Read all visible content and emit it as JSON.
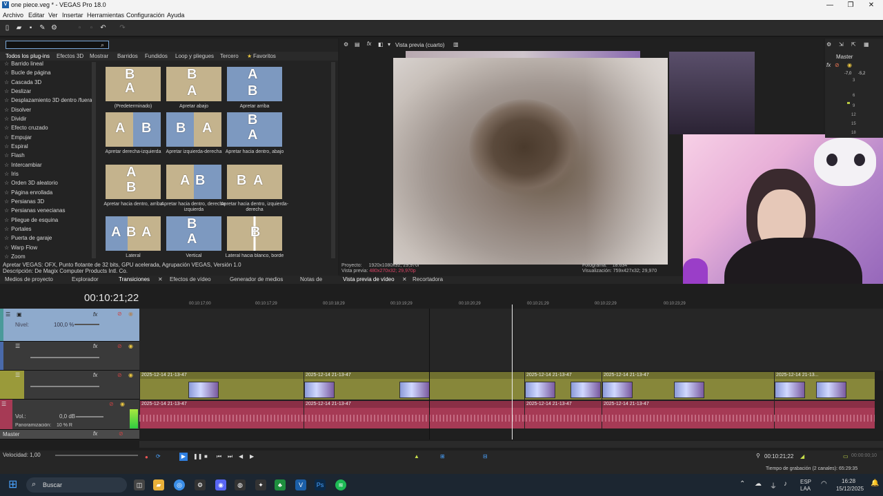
{
  "window": {
    "title": "one piece.veg * - VEGAS Pro 18.0"
  },
  "menu": [
    "Archivo",
    "Editar",
    "Ver",
    "Insertar",
    "Herramientas",
    "Configuración",
    "Ayuda"
  ],
  "plugin_tabs": [
    "Todos los plug-ins",
    "Efectos 3D",
    "Mostrar",
    "Barridos",
    "Fundidos",
    "Loop y pliegues",
    "Tercero",
    "Favoritos"
  ],
  "transitions_list": [
    "Barrido lineal",
    "Bucle de página",
    "Cascada 3D",
    "Deslizar",
    "Desplazamiento 3D dentro /fuera",
    "Disolver",
    "Dividir",
    "Efecto cruzado",
    "Empujar",
    "Espiral",
    "Flash",
    "Intercambiar",
    "Iris",
    "Orden 3D aleatorio",
    "Página enrollada",
    "Persianas 3D",
    "Persianas venecianas",
    "Pliegue de esquina",
    "Portales",
    "Puerta de garaje",
    "Warp Flow",
    "Zoom"
  ],
  "presets": [
    "(Predeterminado)",
    "Apretar abajo",
    "Apretar arriba",
    "Apretar derecha-izquierda",
    "Apretar izquierda-derecha",
    "Apretar hacia dentro, abajo",
    "Apretar hacia dentro, arriba",
    "Apretar hacia dentro, derecha-izquierda",
    "Apretar hacia dentro, izquierda-derecha",
    "Lateral",
    "Vertical",
    "Lateral hacia blanco, borde blanco"
  ],
  "plugin_status": {
    "line1": "Apretar VEGAS: OFX, Punto flotante de 32 bits, GPU acelerada, Agrupación VEGAS, Versión 1.0",
    "line2": "Descripción: De Magix Computer Products Intl. Co."
  },
  "lower_tabs": [
    "Medios de proyecto",
    "Explorador",
    "Transiciones",
    "Efectos de vídeo",
    "Generador de medios",
    "Notas de",
    "Vista previa de vídeo",
    "Recortadora"
  ],
  "preview": {
    "mode": "Vista previa (cuarto)",
    "proyecto_label": "Proyecto:",
    "proyecto_val": "1920x1080x32; 29,970i",
    "vista_label": "Vista previa:",
    "vista_val": "480x270x32; 29,970p",
    "fotograma_label": "Fotograma:",
    "fotograma_val": "18.634",
    "visualizacion_label": "Visualización:",
    "visualizacion_val": "759x427x32; 29,970"
  },
  "mixer": {
    "title": "Master",
    "left": "-7,0",
    "right": "-5,2",
    "scale": [
      "3",
      "-",
      "6",
      "9",
      "12",
      "15",
      "18"
    ]
  },
  "timeline": {
    "timecode": "00:10:21;22",
    "ruler": [
      "00:10:17;00",
      "00:10:17;29",
      "00:10:18;29",
      "00:10:19;29",
      "00:10:20;29",
      "00:10:21;29",
      "00:10:22;29",
      "00:10:23;29"
    ],
    "track1_level_label": "Nivel:",
    "track1_level_val": "100,0 %",
    "audio_vol_label": "Vol.:",
    "audio_vol_val": "0,0 dB",
    "audio_pan_label": "Panoramización:",
    "audio_pan_val": "10 % R",
    "master_label": "Master",
    "clip_name": "2025-12-14 21-13-47",
    "clip_name_short": "2025-12-14 21-13...",
    "velocidad": "Velocidad: 1,00",
    "bottom_time": "00:10:21;22",
    "bottom_time2": "00:00:00;10",
    "recording": "Tiempo de grabación (2 canales): 65:29:35"
  },
  "taskbar": {
    "search": "Buscar",
    "lang1": "ESP",
    "lang2": "LAA",
    "time": "16:28",
    "date": "15/12/2025"
  }
}
